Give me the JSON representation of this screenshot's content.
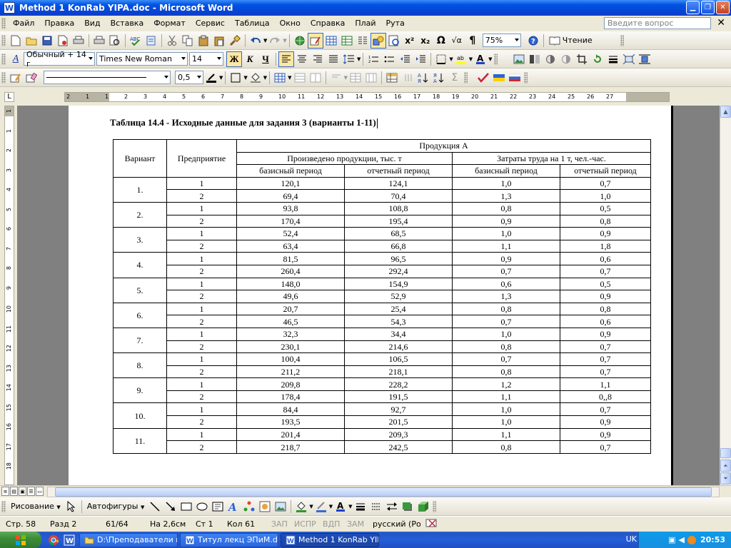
{
  "window": {
    "title": "Method 1 KonRab YIPA.doc - Microsoft Word"
  },
  "menu": {
    "items": [
      "Файл",
      "Правка",
      "Вид",
      "Вставка",
      "Формат",
      "Сервис",
      "Таблица",
      "Окно",
      "Справка",
      "Плай",
      "Рута"
    ],
    "help_placeholder": "Введите вопрос"
  },
  "toolbar": {
    "zoom": "75%",
    "reading_label": "Чтение",
    "style": "Обычный + 14 г",
    "font": "Times New Roman",
    "font_size": "14",
    "line_width": "0,5"
  },
  "ruler": {
    "h_numbers": [
      "2",
      "1",
      "1",
      "2",
      "3",
      "4",
      "5",
      "6",
      "7",
      "8",
      "9",
      "10",
      "11",
      "12",
      "13",
      "14",
      "15",
      "16",
      "17",
      "18",
      "19",
      "20",
      "21",
      "22",
      "23",
      "24",
      "25",
      "26",
      "27"
    ],
    "v_numbers": [
      "1",
      "1",
      "2",
      "3",
      "4",
      "5",
      "6",
      "7",
      "8",
      "9",
      "10",
      "11",
      "12",
      "13",
      "14",
      "15",
      "16",
      "17",
      "18"
    ]
  },
  "document": {
    "title": "Таблица 14.4 - Исходные данные для задания 3 (варианты 1-11)",
    "table": {
      "h_variant": "Вариант",
      "h_enterprise": "Предприятие",
      "h_product": "Продукция А",
      "h_produced": "Произведено продукции, тыс. т",
      "h_labor": "Затраты труда на 1 т, чел.-час.",
      "h_base": "базисный период",
      "h_report": "отчетный период",
      "variants": [
        {
          "label": "1.",
          "rows": [
            [
              "1",
              "120,1",
              "124,1",
              "1,0",
              "0,7"
            ],
            [
              "2",
              "69,4",
              "70,4",
              "1,3",
              "1,0"
            ]
          ]
        },
        {
          "label": "2.",
          "rows": [
            [
              "1",
              "93,8",
              "108,8",
              "0,8",
              "0,5"
            ],
            [
              "2",
              "170,4",
              "195,4",
              "0,9",
              "0,8"
            ]
          ]
        },
        {
          "label": "3.",
          "rows": [
            [
              "1",
              "52,4",
              "68,5",
              "1,0",
              "0,9"
            ],
            [
              "2",
              "63,4",
              "66,8",
              "1,1",
              "1,8"
            ]
          ]
        },
        {
          "label": "4.",
          "rows": [
            [
              "1",
              "81,5",
              "96,5",
              "0,9",
              "0,6"
            ],
            [
              "2",
              "260,4",
              "292,4",
              "0,7",
              "0,7"
            ]
          ]
        },
        {
          "label": "5.",
          "rows": [
            [
              "1",
              "148,0",
              "154,9",
              "0,6",
              "0,5"
            ],
            [
              "2",
              "49,6",
              "52,9",
              "1,3",
              "0,9"
            ]
          ]
        },
        {
          "label": "6.",
          "rows": [
            [
              "1",
              "20,7",
              "25,4",
              "0,8",
              "0,8"
            ],
            [
              "2",
              "46,5",
              "54,3",
              "0,7",
              "0,6"
            ]
          ]
        },
        {
          "label": "7.",
          "rows": [
            [
              "1",
              "32,3",
              "34,4",
              "1,0",
              "0,9"
            ],
            [
              "2",
              "230,1",
              "214,6",
              "0,8",
              "0,7"
            ]
          ]
        },
        {
          "label": "8.",
          "rows": [
            [
              "1",
              "100,4",
              "106,5",
              "0,7",
              "0,7"
            ],
            [
              "2",
              "211,2",
              "218,1",
              "0,8",
              "0,7"
            ]
          ]
        },
        {
          "label": "9.",
          "rows": [
            [
              "1",
              "209,8",
              "228,2",
              "1,2",
              "1,1"
            ],
            [
              "2",
              "178,4",
              "191,5",
              "1,1",
              "0,,8"
            ]
          ]
        },
        {
          "label": "10.",
          "rows": [
            [
              "1",
              "84,4",
              "92,7",
              "1,0",
              "0,7"
            ],
            [
              "2",
              "193,5",
              "201,5",
              "1,0",
              "0,9"
            ]
          ]
        },
        {
          "label": "11.",
          "rows": [
            [
              "1",
              "201,4",
              "209,3",
              "1,1",
              "0,9"
            ],
            [
              "2",
              "218,7",
              "242,5",
              "0,8",
              "0,7"
            ]
          ]
        }
      ]
    }
  },
  "drawing_toolbar": {
    "draw_label": "Рисование",
    "autoshapes_label": "Автофигуры"
  },
  "status": {
    "page": "Стр. 58",
    "section": "Разд 2",
    "pages": "61/64",
    "at": "На 2,6см",
    "line": "Ст 1",
    "col": "Кол 61",
    "rec": "ЗАП",
    "trk": "ИСПР",
    "ext": "ВДП",
    "ovr": "ЗАМ",
    "language": "русский (Ро"
  },
  "taskbar": {
    "items": [
      "D:\\Преподаватели к...",
      "Титул лекц ЭПиМ.do...",
      "Method 1 KonRab YIP..."
    ],
    "lang": "UK",
    "time": "20:53"
  },
  "colors": {
    "xp_blue": "#0054e3",
    "accent": "#316ac5"
  }
}
